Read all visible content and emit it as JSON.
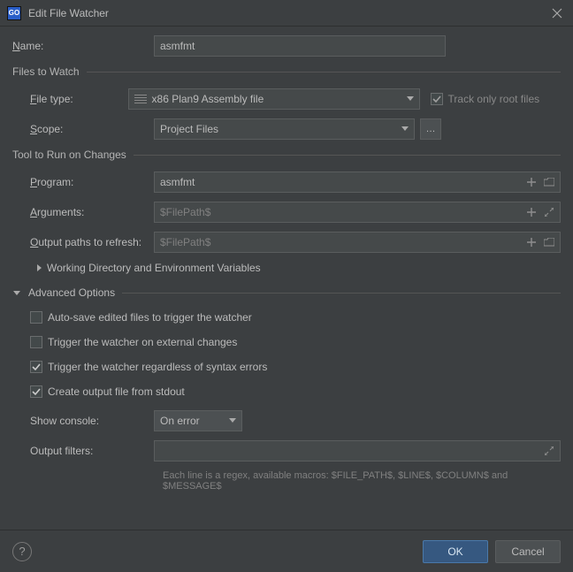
{
  "window": {
    "title": "Edit File Watcher"
  },
  "form": {
    "name_label": "Name:",
    "name_value": "asmfmt"
  },
  "files_to_watch": {
    "legend": "Files to Watch",
    "file_type_label": "File type:",
    "file_type_value": "x86 Plan9 Assembly file",
    "scope_label": "Scope:",
    "scope_value": "Project Files",
    "track_label": "Track only root files",
    "track_checked": true
  },
  "tool": {
    "legend": "Tool to Run on Changes",
    "program_label": "Program:",
    "program_value": "asmfmt",
    "arguments_label": "Arguments:",
    "arguments_value": "$FilePath$",
    "output_label": "Output paths to refresh:",
    "output_value": "$FilePath$",
    "wd_env_label": "Working Directory and Environment Variables"
  },
  "advanced": {
    "legend": "Advanced Options",
    "auto_save_label": "Auto-save edited files to trigger the watcher",
    "auto_save_checked": false,
    "trigger_external_label": "Trigger the watcher on external changes",
    "trigger_external_checked": false,
    "trigger_syntax_label": "Trigger the watcher regardless of syntax errors",
    "trigger_syntax_checked": true,
    "create_stdout_label": "Create output file from stdout",
    "create_stdout_checked": true,
    "show_console_label": "Show console:",
    "show_console_value": "On error",
    "output_filters_label": "Output filters:",
    "output_filters_value": "",
    "hint": "Each line is a regex, available macros: $FILE_PATH$, $LINE$, $COLUMN$ and $MESSAGE$"
  },
  "footer": {
    "ok": "OK",
    "cancel": "Cancel"
  }
}
